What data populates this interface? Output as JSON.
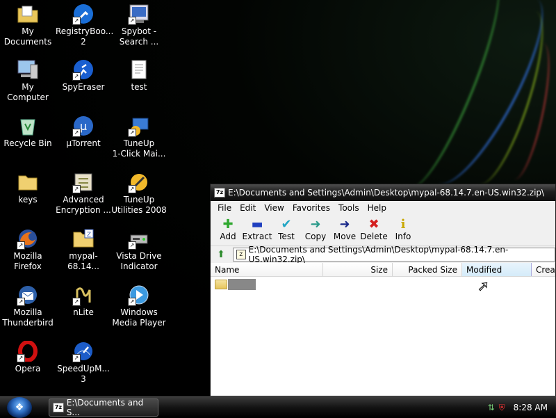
{
  "desktop_icons": [
    {
      "label": "My\nDocuments",
      "icon": "folder-documents-icon"
    },
    {
      "label": "RegistryBoo...\n2",
      "icon": "wrench-icon"
    },
    {
      "label": "Spybot -\nSearch ...",
      "icon": "spybot-icon"
    },
    {
      "label": "My Computer",
      "icon": "computer-icon"
    },
    {
      "label": "SpyEraser",
      "icon": "runner-icon"
    },
    {
      "label": "test",
      "icon": "text-file-icon"
    },
    {
      "label": "Recycle Bin",
      "icon": "recycle-bin-icon"
    },
    {
      "label": "µTorrent",
      "icon": "utorrent-icon"
    },
    {
      "label": "TuneUp\n1-Click Mai...",
      "icon": "tuneup-icon"
    },
    {
      "label": "keys",
      "icon": "folder-icon"
    },
    {
      "label": "Advanced\nEncryption ...",
      "icon": "encryption-icon"
    },
    {
      "label": "TuneUp\nUtilities 2008",
      "icon": "tuneup-icon"
    },
    {
      "label": "Mozilla Firefox",
      "icon": "firefox-icon"
    },
    {
      "label": "mypal-68.14...",
      "icon": "zip-icon"
    },
    {
      "label": "Vista Drive\nIndicator",
      "icon": "drive-icon"
    },
    {
      "label": "Mozilla\nThunderbird",
      "icon": "thunderbird-icon"
    },
    {
      "label": "nLite",
      "icon": "nlite-icon"
    },
    {
      "label": "Windows\nMedia Player",
      "icon": "media-player-icon"
    },
    {
      "label": "Opera",
      "icon": "opera-icon"
    },
    {
      "label": "SpeedUpM...\n3",
      "icon": "speedometer-icon"
    }
  ],
  "window": {
    "app_icon": "7z",
    "title": "E:\\Documents and Settings\\Admin\\Desktop\\mypal-68.14.7.en-US.win32.zip\\",
    "menu": [
      "File",
      "Edit",
      "View",
      "Favorites",
      "Tools",
      "Help"
    ],
    "toolbar": [
      {
        "label": "Add",
        "icon": "plus-icon",
        "glyph": "✚",
        "color": "#2fa82f"
      },
      {
        "label": "Extract",
        "icon": "minus-icon",
        "glyph": "▬",
        "color": "#1f3fbf"
      },
      {
        "label": "Test",
        "icon": "check-icon",
        "glyph": "✔",
        "color": "#22a6c4"
      },
      {
        "label": "Copy",
        "icon": "arrow-right-icon",
        "glyph": "➜",
        "color": "#2a9a8a"
      },
      {
        "label": "Move",
        "icon": "arrow-right-icon",
        "glyph": "➜",
        "color": "#1a2a8a"
      },
      {
        "label": "Delete",
        "icon": "delete-x-icon",
        "glyph": "✖",
        "color": "#d42020"
      },
      {
        "label": "Info",
        "icon": "info-icon",
        "glyph": "i",
        "color": "#c9a800"
      }
    ],
    "address": "E:\\Documents and Settings\\Admin\\Desktop\\mypal-68.14.7.en-US.win32.zip\\",
    "columns": [
      "Name",
      "Size",
      "Packed Size",
      "Modified",
      "Creat"
    ]
  },
  "taskbar": {
    "task_label": "E:\\Documents and S...",
    "clock": "8:28 AM"
  }
}
